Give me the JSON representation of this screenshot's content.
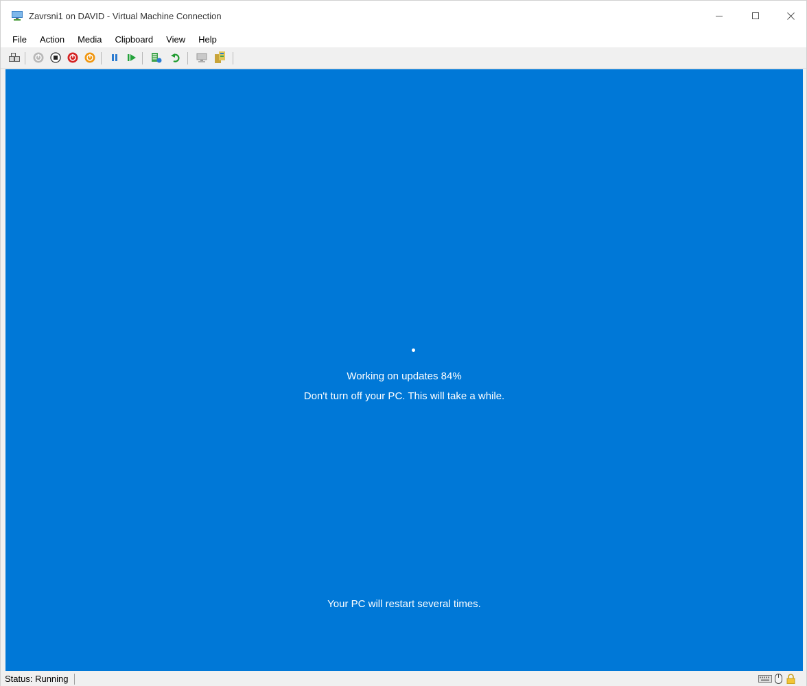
{
  "window": {
    "title": "Zavrsni1 on DAVID - Virtual Machine Connection"
  },
  "menu": {
    "items": [
      "File",
      "Action",
      "Media",
      "Clipboard",
      "View",
      "Help"
    ]
  },
  "toolbar": {
    "icons": [
      "ctrl-alt-del-icon",
      "start-icon",
      "turn-off-icon",
      "shut-down-icon",
      "save-icon",
      "pause-icon",
      "resume-icon",
      "checkpoint-icon",
      "revert-icon",
      "enhanced-session-icon",
      "share-icon"
    ]
  },
  "screen": {
    "background_color": "#0078d7",
    "line1": "Working on updates  84%",
    "line2": "Don't turn off your PC. This will take a while.",
    "line3": "Your PC will restart several times.",
    "progress_percent": 84
  },
  "status": {
    "text": "Status: Running"
  }
}
